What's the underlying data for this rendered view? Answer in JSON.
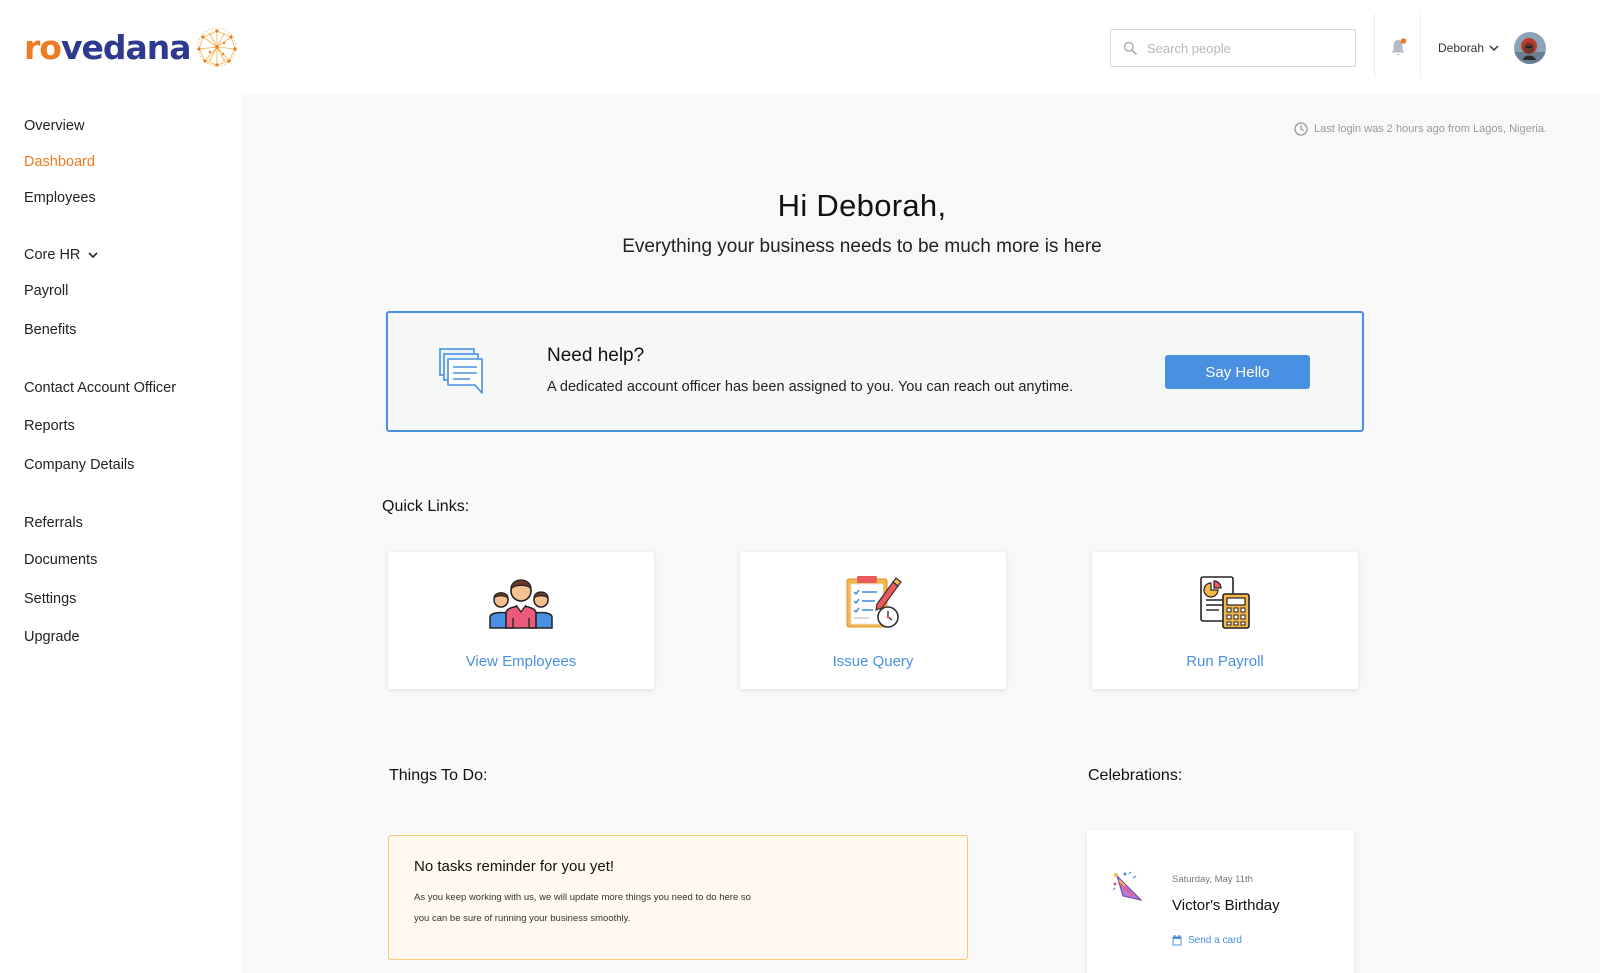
{
  "brand": {
    "logo_part1": "ro",
    "logo_part2": "vedana",
    "accent": "#ee7b22",
    "primary": "#2e3a8f",
    "link": "#4a90e2"
  },
  "header": {
    "search_placeholder": "Search people",
    "user_name": "Deborah",
    "notification_dot": true
  },
  "sidebar": {
    "items": [
      {
        "label": "Overview"
      },
      {
        "label": "Dashboard",
        "active": true
      },
      {
        "label": "Employees"
      },
      {
        "label": "Core HR"
      },
      {
        "label": "Payroll"
      },
      {
        "label": "Benefits"
      },
      {
        "label": "Contact Account Officer"
      },
      {
        "label": "Reports"
      },
      {
        "label": "Company Details"
      },
      {
        "label": "Referrals"
      },
      {
        "label": "Documents"
      },
      {
        "label": "Settings"
      },
      {
        "label": "Upgrade"
      }
    ]
  },
  "main": {
    "last_login": "Last login was 2 hours ago from Lagos, Nigeria.",
    "greeting_title": "Hi Deborah,",
    "greeting_subtitle": "Everything your business needs to be much more is here",
    "help": {
      "title": "Need help?",
      "description": "A dedicated account officer has been assigned to you. You can reach out anytime.",
      "button": "Say Hello"
    },
    "quick_links_title": "Quick Links:",
    "quick_links": [
      {
        "label": "View Employees",
        "icon": "employees-icon"
      },
      {
        "label": "Issue Query",
        "icon": "clipboard-query-icon"
      },
      {
        "label": "Run Payroll",
        "icon": "payroll-calculator-icon"
      }
    ],
    "todo_title": "Things To Do:",
    "todo": {
      "title": "No tasks reminder for you yet!",
      "line1": "As you keep working with us, we will update more things you need to do here so",
      "line2": "you can be sure of running your business smoothly."
    },
    "celebrations_title": "Celebrations:",
    "celebration": {
      "date": "Saturday, May 11th",
      "name": "Victor's Birthday",
      "action": "Send a card"
    }
  }
}
